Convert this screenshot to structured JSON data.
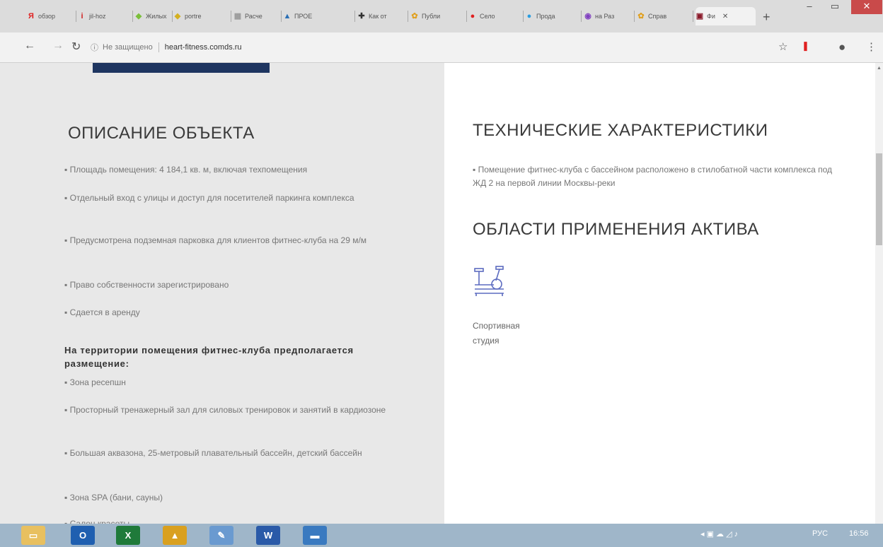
{
  "tabs": [
    {
      "label": "обзор",
      "fav": "Я",
      "color": "#e02020"
    },
    {
      "label": "jil-hoz",
      "fav": "i",
      "color": "#d02020"
    },
    {
      "label": "Жилых",
      "fav": "◆",
      "color": "#7bbf3a"
    },
    {
      "label": "portre",
      "fav": "◆",
      "color": "#d4b020"
    },
    {
      "label": "Расче",
      "fav": "▦",
      "color": "#999999"
    },
    {
      "label": "ПРОЕ",
      "fav": "▲",
      "color": "#2a6fb5"
    },
    {
      "label": "Как от",
      "fav": "✚",
      "color": "#333333"
    },
    {
      "label": "Публи",
      "fav": "✿",
      "color": "#e0a020"
    },
    {
      "label": "Село",
      "fav": "●",
      "color": "#e02020"
    },
    {
      "label": "Прода",
      "fav": "●",
      "color": "#2a9de0"
    },
    {
      "label": "на Раз",
      "fav": "◉",
      "color": "#8040c0"
    },
    {
      "label": "Справ",
      "fav": "✿",
      "color": "#e0a020"
    },
    {
      "label": "Фи",
      "fav": "▣",
      "color": "#8a1a2a"
    }
  ],
  "url": {
    "security": "Не защищено",
    "host": "heart-fitness.comds.ru"
  },
  "left": {
    "heading": "ОПИСАНИЕ ОБЪЕКТА",
    "items": [
      "Площадь помещения: 4 184,1 кв. м, включая техпомещения",
      "Отдельный вход с улицы и доступ для посетителей паркинга комплекса",
      "Предусмотрена подземная парковка для клиентов фитнес-клуба на 29 м/м",
      "Право собственности зарегистрировано",
      "Сдается в аренду"
    ],
    "bold_text": "На территории помещения фитнес-клуба предполагается размещение:",
    "items2": [
      "Зона ресепшн",
      "Просторный тренажерный зал для силовых тренировок и занятий в кардиозоне",
      "Большая аквазона, 25-метровый плавательный бассейн, детский бассейн",
      "Зона SPA (бани, сауны)",
      "Салон красоты"
    ]
  },
  "right": {
    "heading_tech": "ТЕХНИЧЕСКИЕ ХАРАКТЕРИСТИКИ",
    "tech_item": "Помещение фитнес-клуба с бассейном расположено в стилобатной части комплекса под ЖД 2 на первой линии Москвы-реки",
    "heading_areas": "ОБЛАСТИ ПРИМЕНЕНИЯ АКТИВА",
    "area_line1": "Спортивная",
    "area_line2": "студия"
  },
  "taskbar": {
    "apps": [
      {
        "name": "explorer",
        "glyph": "▭",
        "color": "#e8c060"
      },
      {
        "name": "outlook",
        "glyph": "O",
        "color": "#1f5fb0"
      },
      {
        "name": "excel",
        "glyph": "X",
        "color": "#1f7a3a"
      },
      {
        "name": "chart",
        "glyph": "▲",
        "color": "#d9a020"
      },
      {
        "name": "paint",
        "glyph": "✎",
        "color": "#6a9ad0"
      },
      {
        "name": "word",
        "glyph": "W",
        "color": "#2a5aa8"
      },
      {
        "name": "screen",
        "glyph": "▬",
        "color": "#3a7ac0"
      }
    ],
    "lang": "РУС",
    "time": "16:56"
  }
}
